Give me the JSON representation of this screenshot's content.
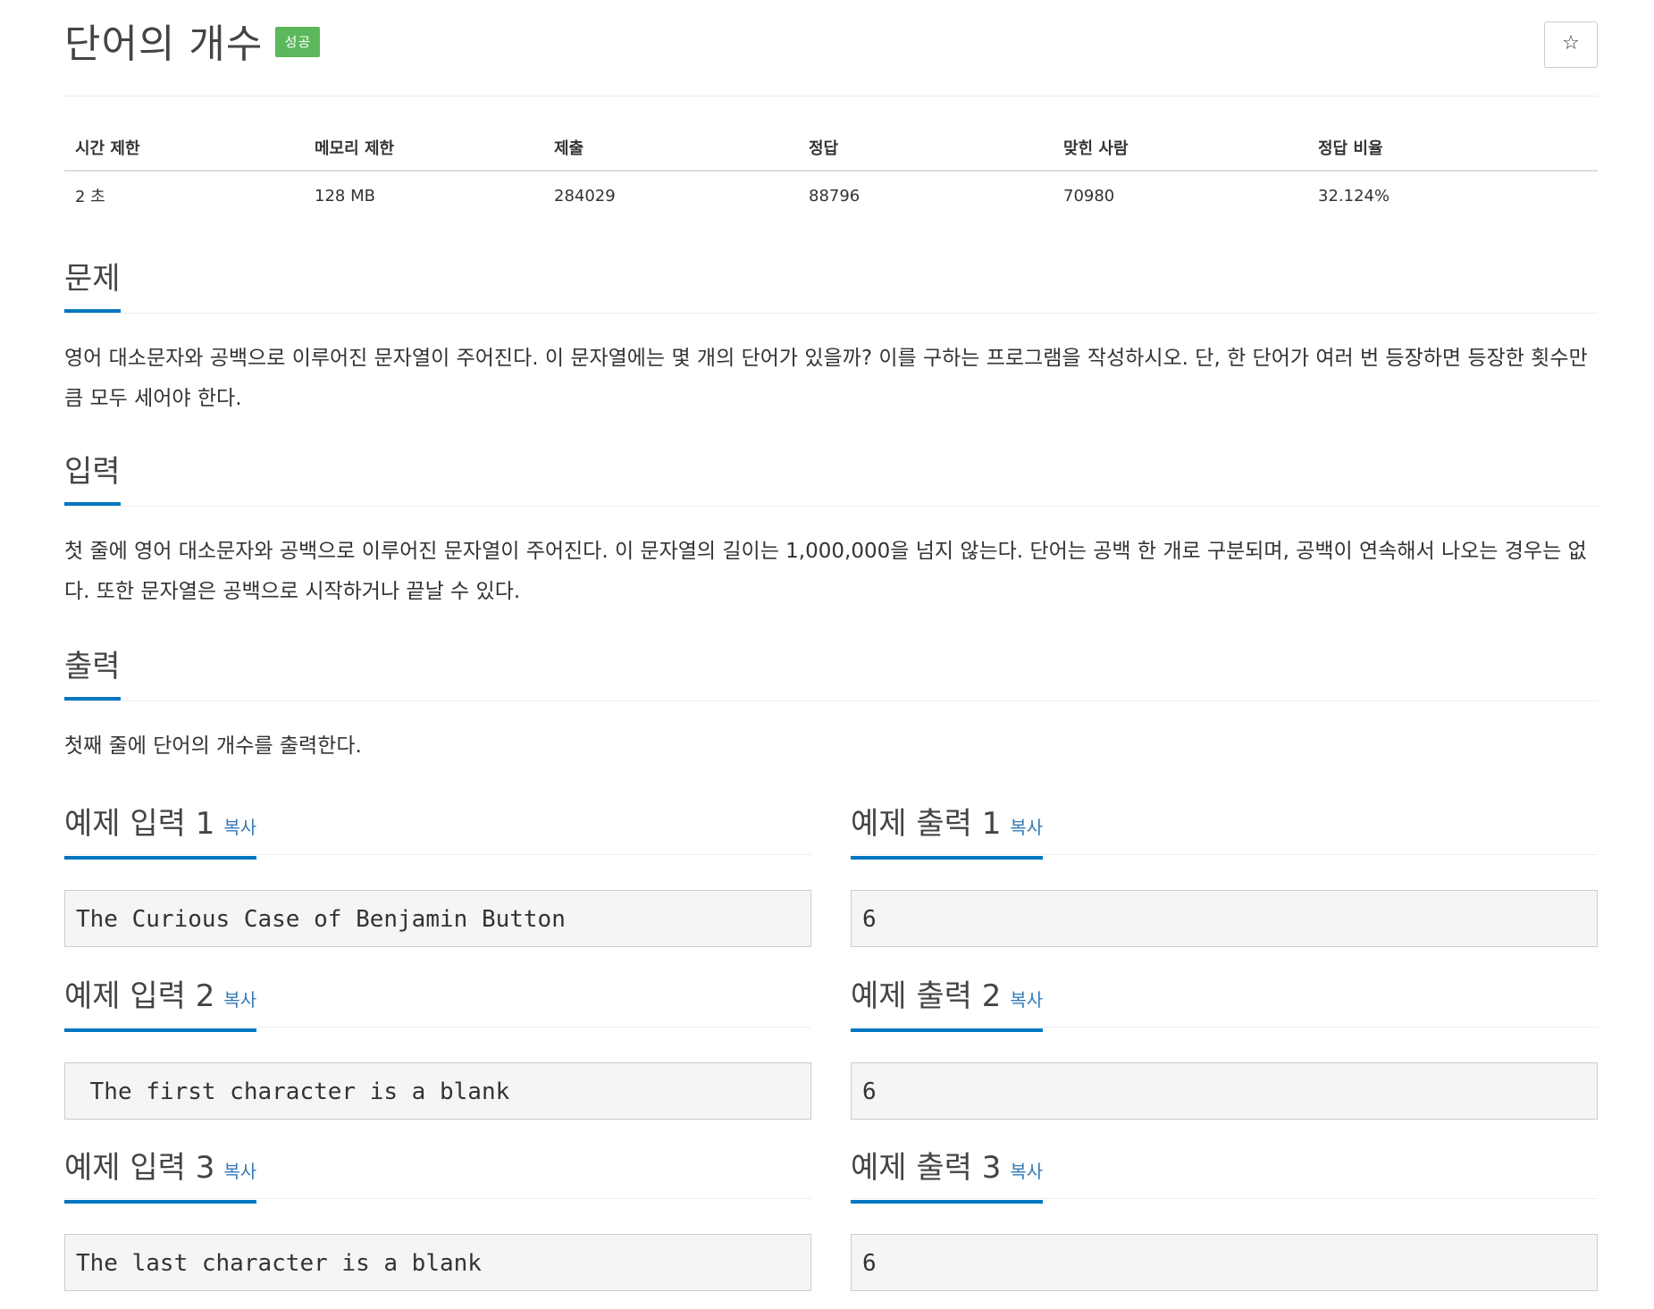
{
  "problem": {
    "title": "단어의 개수",
    "badge": "성공",
    "star_icon": "☆"
  },
  "info_table": {
    "headers": [
      "시간 제한",
      "메모리 제한",
      "제출",
      "정답",
      "맞힌 사람",
      "정답 비율"
    ],
    "values": [
      "2 초",
      "128 MB",
      "284029",
      "88796",
      "70980",
      "32.124%"
    ]
  },
  "sections": {
    "problem": {
      "heading": "문제",
      "text": "영어 대소문자와 공백으로 이루어진 문자열이 주어진다. 이 문자열에는 몇 개의 단어가 있을까? 이를 구하는 프로그램을 작성하시오. 단, 한 단어가 여러 번 등장하면 등장한 횟수만큼 모두 세어야 한다."
    },
    "input": {
      "heading": "입력",
      "text": "첫 줄에 영어 대소문자와 공백으로 이루어진 문자열이 주어진다. 이 문자열의 길이는 1,000,000을 넘지 않는다. 단어는 공백 한 개로 구분되며, 공백이 연속해서 나오는 경우는 없다. 또한 문자열은 공백으로 시작하거나 끝날 수 있다."
    },
    "output": {
      "heading": "출력",
      "text": "첫째 줄에 단어의 개수를 출력한다."
    }
  },
  "examples": [
    {
      "input_heading": "예제 입력 1",
      "output_heading": "예제 출력 1",
      "copy_label": "복사",
      "input": "The Curious Case of Benjamin Button",
      "output": "6"
    },
    {
      "input_heading": "예제 입력 2",
      "output_heading": "예제 출력 2",
      "copy_label": "복사",
      "input": " The first character is a blank",
      "output": "6"
    },
    {
      "input_heading": "예제 입력 3",
      "output_heading": "예제 출력 3",
      "copy_label": "복사",
      "input": "The last character is a blank ",
      "output": "6"
    }
  ],
  "colors": {
    "badge_success": "#5cb85c",
    "heading_underline": "#0076c0",
    "copy_link": "#337ab7"
  }
}
